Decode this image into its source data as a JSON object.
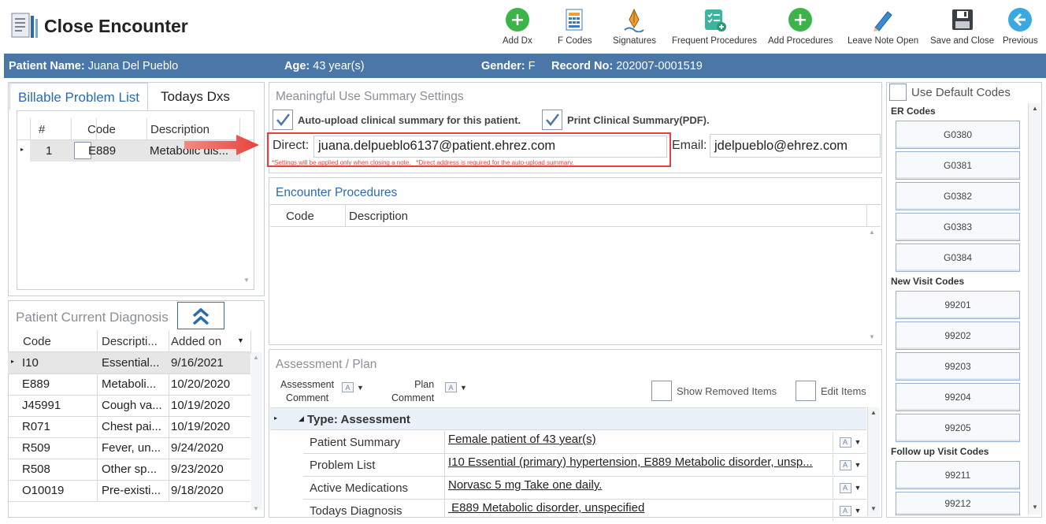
{
  "app": {
    "title": "Close Encounter"
  },
  "toolbar": [
    {
      "label": "Add Dx",
      "icon": "add-icon"
    },
    {
      "label": "F Codes",
      "icon": "fcodes-icon"
    },
    {
      "label": "Signatures",
      "icon": "signature-icon"
    },
    {
      "label": "Frequent Procedures",
      "icon": "checklist-icon"
    },
    {
      "label": "Add Procedures",
      "icon": "add-icon"
    },
    {
      "label": "Leave Note Open",
      "icon": "pencil-icon"
    },
    {
      "label": "Save and Close",
      "icon": "save-icon"
    },
    {
      "label": "Previous",
      "icon": "back-arrow-icon"
    }
  ],
  "patient": {
    "name_label": "Patient Name:",
    "name": "Juana Del Pueblo",
    "age_label": "Age:",
    "age": "43 year(s)",
    "gender_label": "Gender:",
    "gender": "F",
    "record_label": "Record No:",
    "record": "202007-0001519"
  },
  "problem_list": {
    "tabs": [
      "Billable Problem List",
      "Todays Dxs"
    ],
    "headers": [
      "#",
      "Code",
      "Description"
    ],
    "rows": [
      {
        "num": "1",
        "code": "E889",
        "desc": "Metabolic dis..."
      }
    ]
  },
  "current_dx": {
    "title": "Patient Current Diagnosis",
    "headers": [
      "Code",
      "Descripti...",
      "Added on"
    ],
    "rows": [
      {
        "code": "I10",
        "desc": "Essential...",
        "date": "9/16/2021"
      },
      {
        "code": "E889",
        "desc": "Metaboli...",
        "date": "10/20/2020"
      },
      {
        "code": "J45991",
        "desc": "Cough va...",
        "date": "10/19/2020"
      },
      {
        "code": "R071",
        "desc": "Chest pai...",
        "date": "10/19/2020"
      },
      {
        "code": "R509",
        "desc": "Fever, un...",
        "date": "9/24/2020"
      },
      {
        "code": "R508",
        "desc": "Other sp...",
        "date": "9/23/2020"
      },
      {
        "code": "O10019",
        "desc": "Pre-existi...",
        "date": "9/18/2020"
      }
    ]
  },
  "mu": {
    "title": "Meaningful Use Summary Settings",
    "auto_upload": "Auto-upload clinical summary for this patient.",
    "print_summary": "Print Clinical Summary(PDF).",
    "direct_label": "Direct:",
    "direct_value": "juana.delpueblo6137@patient.ehrez.com",
    "email_label": "Email:",
    "email_value": "jdelpueblo@ehrez.com",
    "note": "*Settings will be applied only when closing a note.   *Direct address is required for the auto-upload summary."
  },
  "procedures": {
    "title": "Encounter Procedures",
    "headers": [
      "Code",
      "Description"
    ]
  },
  "assessment": {
    "title": "Assessment / Plan",
    "assessment_comment": "Assessment Comment",
    "assessment_comment_line1": "Assessment",
    "assessment_comment_line2": "Comment",
    "plan_comment_line1": "Plan",
    "plan_comment_line2": "Comment",
    "show_removed": "Show Removed Items",
    "edit_items": "Edit Items",
    "group": "Type: Assessment",
    "rows": [
      {
        "label": "Patient Summary",
        "value": "Female patient of 43 year(s)"
      },
      {
        "label": "Problem List",
        "value": "I10 Essential (primary) hypertension, E889 Metabolic disorder, unsp..."
      },
      {
        "label": "Active Medications",
        "value": "Norvasc 5 mg Take one daily. "
      },
      {
        "label": "Todays Diagnosis",
        "value": " E889 Metabolic disorder, unspecified"
      }
    ]
  },
  "codes": {
    "use_default": "Use Default Codes",
    "er_title": "ER Codes",
    "er": [
      "G0380",
      "G0381",
      "G0382",
      "G0383",
      "G0384"
    ],
    "new_title": "New Visit Codes",
    "new": [
      "99201",
      "99202",
      "99203",
      "99204",
      "99205"
    ],
    "follow_title": "Follow up Visit Codes",
    "follow": [
      "99211",
      "99212"
    ]
  },
  "colors": {
    "accent": "#4a76a8",
    "highlight": "#e8413c",
    "link": "#2a6bb0"
  }
}
